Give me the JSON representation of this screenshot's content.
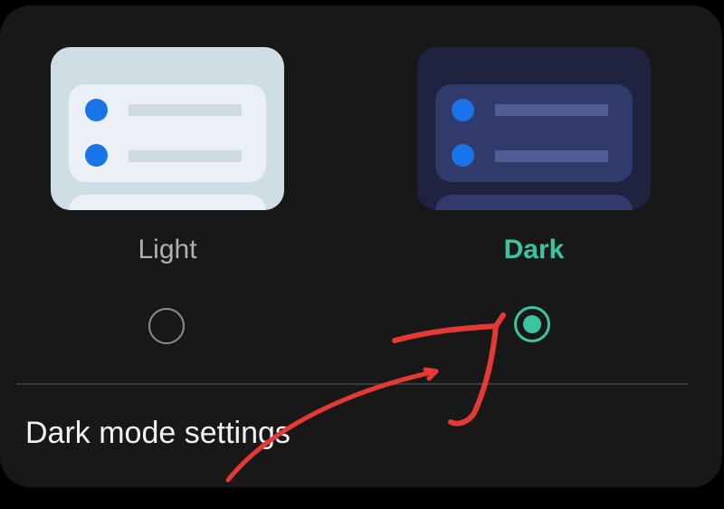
{
  "theme_options": [
    {
      "id": "light",
      "label": "Light",
      "selected": false
    },
    {
      "id": "dark",
      "label": "Dark",
      "selected": true
    }
  ],
  "settings_row": {
    "label": "Dark mode settings"
  },
  "colors": {
    "accent": "#3cc4a0",
    "background": "#181818",
    "preview_dot": "#1a73e8",
    "annotation_arrow": "#e53935"
  },
  "icons": [
    "radio-unchecked-icon",
    "radio-checked-icon",
    "hand-drawn-arrow-icon"
  ]
}
